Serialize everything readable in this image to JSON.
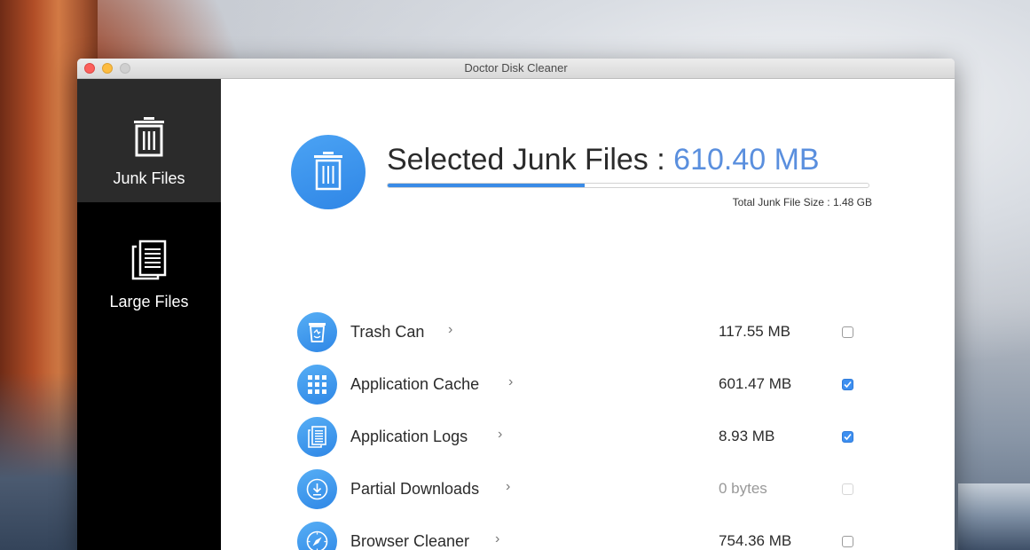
{
  "window": {
    "title": "Doctor Disk Cleaner"
  },
  "sidebar": {
    "items": [
      {
        "label": "Junk Files",
        "active": true,
        "icon": "trash-icon"
      },
      {
        "label": "Large Files",
        "active": false,
        "icon": "documents-icon"
      }
    ]
  },
  "summary": {
    "title_prefix": "Selected Junk Files : ",
    "selected_value": "610.40 MB",
    "progress_fraction": 0.41,
    "total_label": "Total Junk File Size : 1.48 GB",
    "icon": "trash-icon"
  },
  "categories": [
    {
      "label": "Trash Can",
      "chevron": "›",
      "size": "117.55 MB",
      "checked": false,
      "disabled": false,
      "icon": "trash-can-icon"
    },
    {
      "label": "Application Cache",
      "chevron": "›",
      "size": "601.47 MB",
      "checked": true,
      "disabled": false,
      "icon": "grid-icon"
    },
    {
      "label": "Application Logs",
      "chevron": "›",
      "size": "8.93 MB",
      "checked": true,
      "disabled": false,
      "icon": "logs-icon"
    },
    {
      "label": "Partial Downloads",
      "chevron": "›",
      "size": "0 bytes",
      "checked": false,
      "disabled": true,
      "icon": "download-icon"
    },
    {
      "label": "Browser Cleaner",
      "chevron": "›",
      "size": "754.36 MB",
      "checked": false,
      "disabled": false,
      "icon": "compass-icon"
    }
  ],
  "colors": {
    "accent": "#3a8be6",
    "value_text": "#5a8fde",
    "sidebar_bg": "#000000",
    "sidebar_active": "#2b2b2b"
  }
}
